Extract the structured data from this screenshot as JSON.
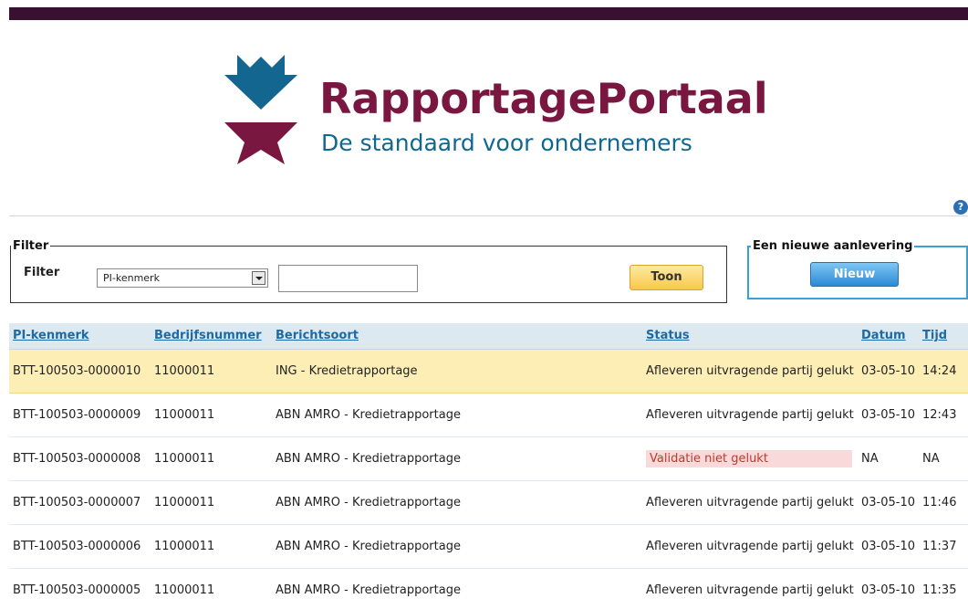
{
  "brand": {
    "title": "RapportagePortaal",
    "subtitle": "De standaard voor ondernemers",
    "colors": {
      "maroon": "#7a1740",
      "blue": "#12668f"
    }
  },
  "help_icon": "?",
  "filter": {
    "legend": "Filter",
    "label": "Filter",
    "select_value": "PI-kenmerk",
    "input_value": "",
    "button_label": "Toon"
  },
  "new_delivery": {
    "legend": "Een nieuwe aanlevering",
    "button_label": "Nieuw"
  },
  "table": {
    "headers": [
      "PI-kenmerk",
      "Bedrijfsnummer",
      "Berichtsoort",
      "Status",
      "Datum",
      "Tijd"
    ],
    "rows": [
      {
        "pi": "BTT-100503-0000010",
        "bedrijfsnummer": "11000011",
        "berichtsoort": "ING - Kredietrapportage",
        "status": "Afleveren uitvragende partij gelukt",
        "datum": "03-05-10",
        "tijd": "14:24"
      },
      {
        "pi": "BTT-100503-0000009",
        "bedrijfsnummer": "11000011",
        "berichtsoort": "ABN AMRO - Kredietrapportage",
        "status": "Afleveren uitvragende partij gelukt",
        "datum": "03-05-10",
        "tijd": "12:43"
      },
      {
        "pi": "BTT-100503-0000008",
        "bedrijfsnummer": "11000011",
        "berichtsoort": "ABN AMRO - Kredietrapportage",
        "status": "Validatie niet gelukt",
        "datum": "NA",
        "tijd": "NA"
      },
      {
        "pi": "BTT-100503-0000007",
        "bedrijfsnummer": "11000011",
        "berichtsoort": "ABN AMRO - Kredietrapportage",
        "status": "Afleveren uitvragende partij gelukt",
        "datum": "03-05-10",
        "tijd": "11:46"
      },
      {
        "pi": "BTT-100503-0000006",
        "bedrijfsnummer": "11000011",
        "berichtsoort": "ABN AMRO - Kredietrapportage",
        "status": "Afleveren uitvragende partij gelukt",
        "datum": "03-05-10",
        "tijd": "11:37"
      },
      {
        "pi": "BTT-100503-0000005",
        "bedrijfsnummer": "11000011",
        "berichtsoort": "ABN AMRO - Kredietrapportage",
        "status": "Afleveren uitvragende partij gelukt",
        "datum": "03-05-10",
        "tijd": "11:35"
      }
    ]
  }
}
